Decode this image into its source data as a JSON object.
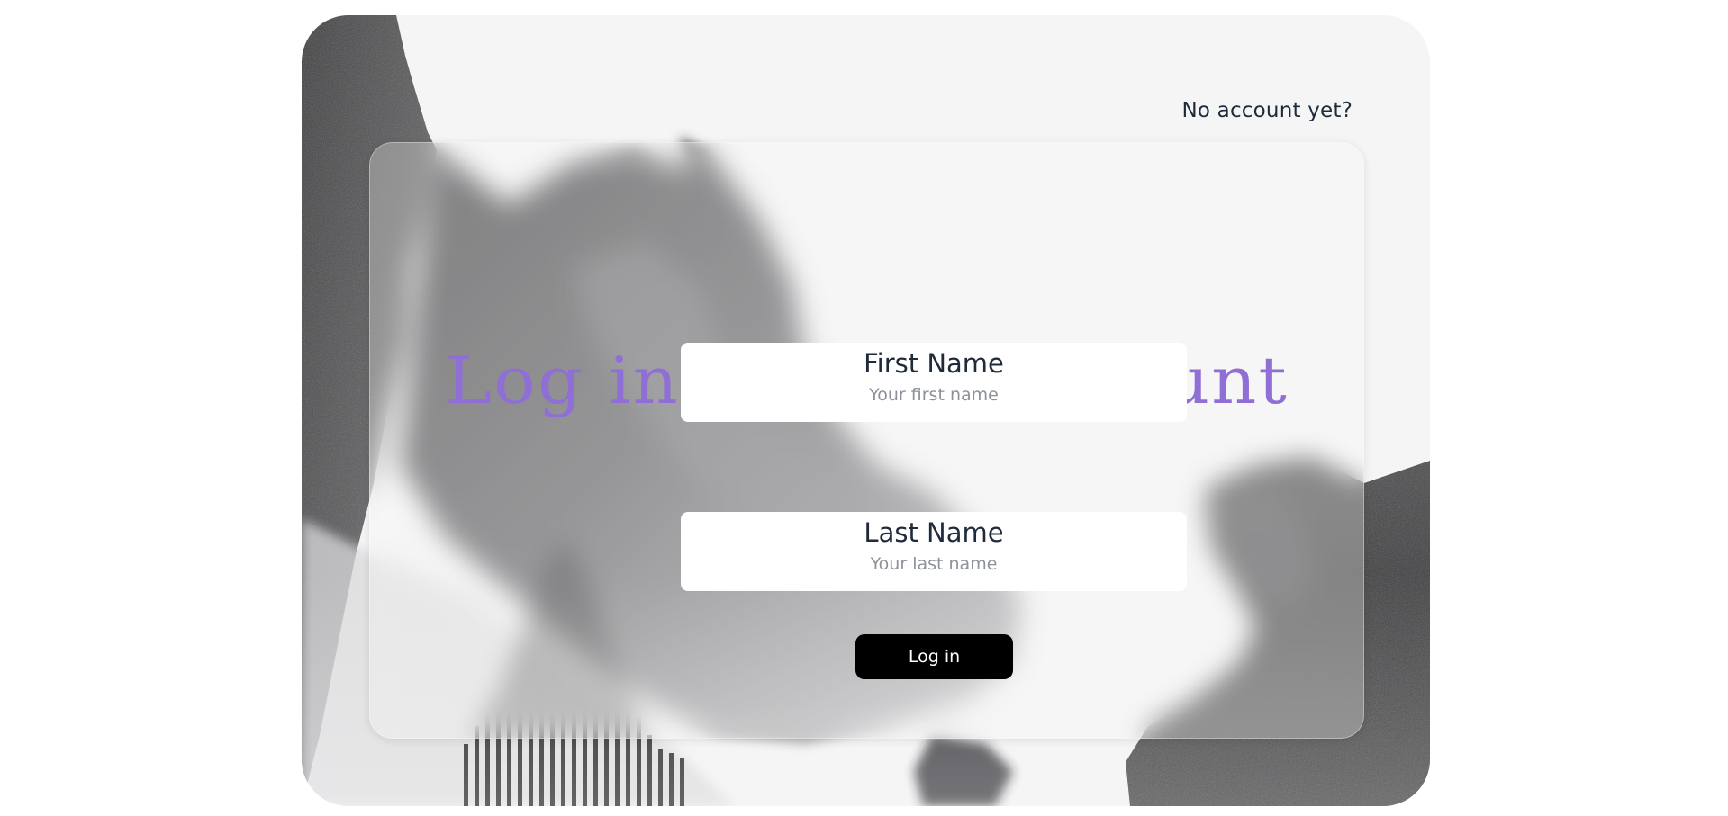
{
  "header": {
    "signup_prompt": "No account yet?"
  },
  "login": {
    "title": "Log in to your account",
    "first_name": {
      "label": "First Name",
      "value": "",
      "placeholder": "Your first name"
    },
    "last_name": {
      "label": "Last Name",
      "value": "",
      "placeholder": "Your last name"
    },
    "submit_label": "Log in"
  },
  "colors": {
    "title_accent": "#8f6fd6",
    "button_background": "#000000",
    "button_text": "#ffffff",
    "card_background": "#f5f5f6",
    "text_dark": "#1f2a3a"
  }
}
